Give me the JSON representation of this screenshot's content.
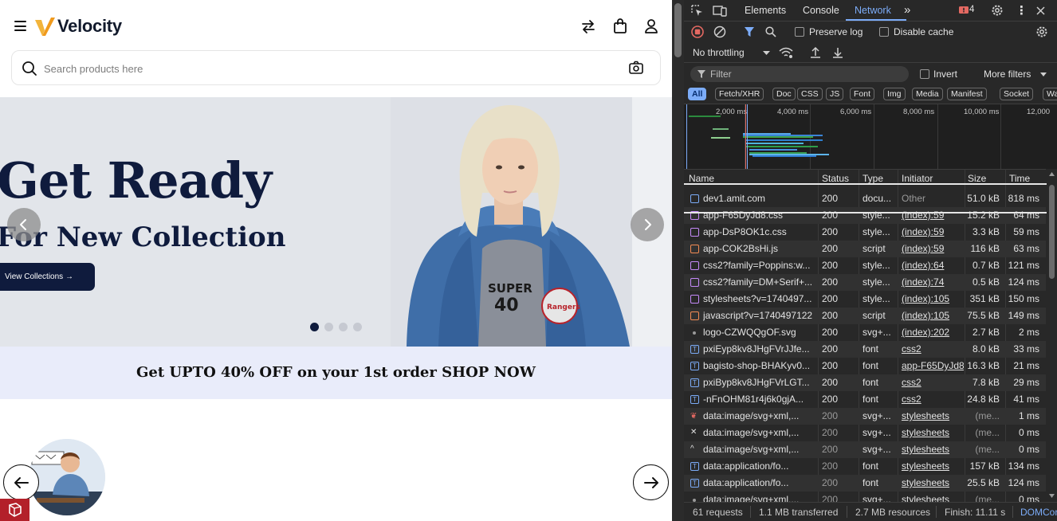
{
  "site": {
    "brand": "Velocity",
    "search_placeholder": "Search products here",
    "hero": {
      "heading": "Get Ready",
      "subheading": "For New Collection",
      "cta": "View Collections →",
      "slide_count": 4,
      "active_slide": 1
    },
    "promo": "Get UPTO 40% OFF on your 1st order SHOP NOW"
  },
  "devtools": {
    "tabs": [
      "Elements",
      "Console",
      "Network"
    ],
    "active_tab": "Network",
    "issues_count": "4",
    "toolbar": {
      "preserve_log": "Preserve log",
      "disable_cache": "Disable cache",
      "throttling": "No throttling"
    },
    "filter_placeholder": "Filter",
    "invert": "Invert",
    "more_filters": "More filters",
    "chips": [
      "All",
      "Fetch/XHR",
      "Doc",
      "CSS",
      "JS",
      "Font",
      "Img",
      "Media",
      "Manifest",
      "Socket",
      "Was"
    ],
    "timeline_ticks": [
      "2,000 ms",
      "4,000 ms",
      "6,000 ms",
      "8,000 ms",
      "10,000 ms",
      "12,000"
    ],
    "columns": [
      "Name",
      "Status",
      "Type",
      "Initiator",
      "Size",
      "Time"
    ],
    "rows": [
      {
        "name": "dev1.amit.com",
        "status": "200",
        "type": "docu...",
        "initiator": "Other",
        "size": "51.0 kB",
        "time": "818 ms",
        "icon": "doc"
      },
      {
        "name": "app-F65DyJd8.css",
        "status": "200",
        "type": "style...",
        "initiator": "(index):59",
        "size": "15.2 kB",
        "time": "64 ms",
        "icon": "css"
      },
      {
        "name": "app-DsP8OK1c.css",
        "status": "200",
        "type": "style...",
        "initiator": "(index):59",
        "size": "3.3 kB",
        "time": "59 ms",
        "icon": "css"
      },
      {
        "name": "app-COK2BsHi.js",
        "status": "200",
        "type": "script",
        "initiator": "(index):59",
        "size": "116 kB",
        "time": "63 ms",
        "icon": "js"
      },
      {
        "name": "css2?family=Poppins:w...",
        "status": "200",
        "type": "style...",
        "initiator": "(index):64",
        "size": "0.7 kB",
        "time": "121 ms",
        "icon": "css"
      },
      {
        "name": "css2?family=DM+Serif+...",
        "status": "200",
        "type": "style...",
        "initiator": "(index):74",
        "size": "0.5 kB",
        "time": "124 ms",
        "icon": "css"
      },
      {
        "name": "stylesheets?v=1740497...",
        "status": "200",
        "type": "style...",
        "initiator": "(index):105",
        "size": "351 kB",
        "time": "150 ms",
        "icon": "css"
      },
      {
        "name": "javascript?v=1740497122",
        "status": "200",
        "type": "script",
        "initiator": "(index):105",
        "size": "75.5 kB",
        "time": "149 ms",
        "icon": "js"
      },
      {
        "name": "logo-CZWQQgOF.svg",
        "status": "200",
        "type": "svg+...",
        "initiator": "(index):202",
        "size": "2.7 kB",
        "time": "2 ms",
        "icon": "svg"
      },
      {
        "name": "pxiEyp8kv8JHgFVrJJfe...",
        "status": "200",
        "type": "font",
        "initiator": "css2",
        "size": "8.0 kB",
        "time": "33 ms",
        "icon": "font"
      },
      {
        "name": "bagisto-shop-BHAKyv0...",
        "status": "200",
        "type": "font",
        "initiator": "app-F65DyJd8",
        "size": "16.3 kB",
        "time": "21 ms",
        "icon": "font"
      },
      {
        "name": "pxiByp8kv8JHgFVrLGT...",
        "status": "200",
        "type": "font",
        "initiator": "css2",
        "size": "7.8 kB",
        "time": "29 ms",
        "icon": "font"
      },
      {
        "name": "-nFnOHM81r4j6k0gjA...",
        "status": "200",
        "type": "font",
        "initiator": "css2",
        "size": "24.8 kB",
        "time": "41 ms",
        "icon": "font"
      },
      {
        "name": "data:image/svg+xml,...",
        "status": "200",
        "type": "svg+...",
        "initiator": "stylesheets",
        "size": "(me...",
        "time": "1 ms",
        "icon": "laravel"
      },
      {
        "name": "data:image/svg+xml,...",
        "status": "200",
        "type": "svg+...",
        "initiator": "stylesheets",
        "size": "(me...",
        "time": "0 ms",
        "icon": "x"
      },
      {
        "name": "data:image/svg+xml,...",
        "status": "200",
        "type": "svg+...",
        "initiator": "stylesheets",
        "size": "(me...",
        "time": "0 ms",
        "icon": "caret"
      },
      {
        "name": "data:application/fo...",
        "status": "200",
        "type": "font",
        "initiator": "stylesheets",
        "size": "157 kB",
        "time": "134 ms",
        "icon": "font"
      },
      {
        "name": "data:application/fo...",
        "status": "200",
        "type": "font",
        "initiator": "stylesheets",
        "size": "25.5 kB",
        "time": "124 ms",
        "icon": "font"
      },
      {
        "name": "data:image/svg+xml,...",
        "status": "200",
        "type": "svg+...",
        "initiator": "stylesheets",
        "size": "(me...",
        "time": "0 ms",
        "icon": "svg"
      }
    ],
    "status_bar": {
      "requests": "61 requests",
      "transferred": "1.1 MB transferred",
      "resources": "2.7 MB resources",
      "finish": "Finish: 11.11 s",
      "domcontent": "DOMCor"
    },
    "colors": {
      "accent": "#7cacf8",
      "panel_bg": "#282828"
    }
  }
}
